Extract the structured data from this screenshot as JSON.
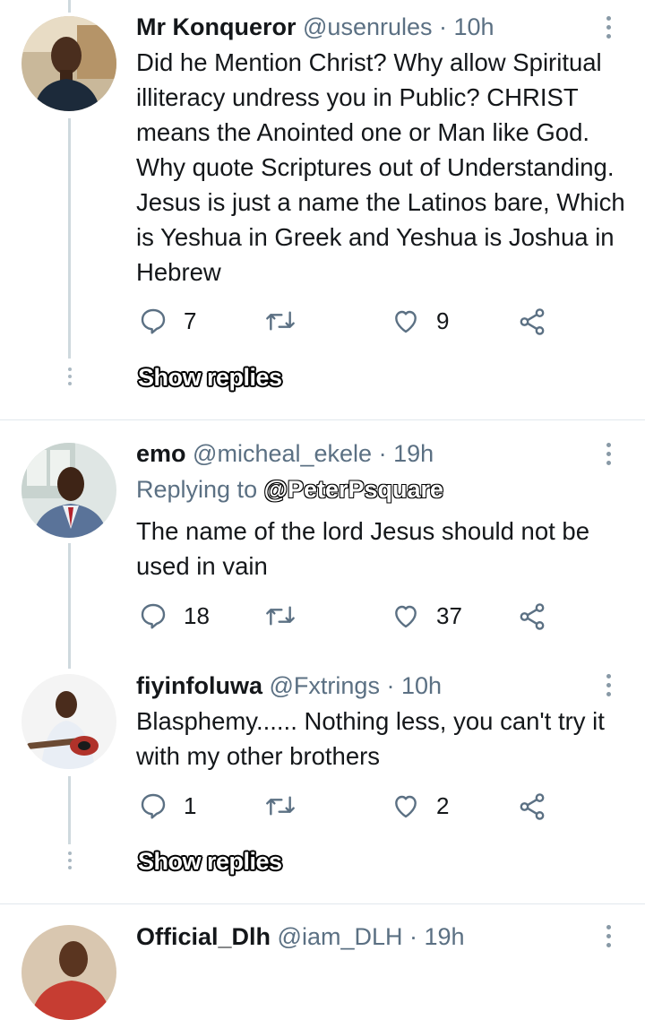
{
  "tweets": [
    {
      "name": "Mr Konqueror",
      "handle": "@usenrules",
      "time": "· 10h",
      "text": "Did he Mention Christ? Why allow Spiritual illiteracy undress you in Public? CHRIST means the Anointed one or Man like God. Why quote Scriptures out of Understanding. Jesus is just a name the Latinos bare, Which is Yeshua in Greek and Yeshua is Joshua in Hebrew",
      "replies": "7",
      "retweets": "",
      "likes": "9",
      "show_replies": "Show replies"
    },
    {
      "name": "emo",
      "handle": "@micheal_ekele",
      "time": "· 19h",
      "replying_prefix": "Replying to",
      "replying_to": "@PeterPsquare",
      "text": "The name of the lord Jesus should not be used in vain",
      "replies": "18",
      "retweets": "",
      "likes": "37"
    },
    {
      "name": "fiyinfoluwa",
      "handle": "@Fxtrings",
      "time": "· 10h",
      "text": "Blasphemy...... Nothing less,  you can't try it with my other brothers",
      "replies": "1",
      "retweets": "",
      "likes": "2",
      "show_replies": "Show replies"
    },
    {
      "name": "Official_Dlh",
      "handle": "@iam_DLH",
      "time": "· 19h"
    }
  ],
  "icons": {
    "reply": "reply-icon",
    "retweet": "retweet-icon",
    "like": "heart-icon",
    "share": "share-icon",
    "more": "more-vertical-icon"
  },
  "colors": {
    "icon": "#5b7083",
    "thread_line": "#cfd9de",
    "divider": "#e1e8ed",
    "accent": "#1da1f2"
  }
}
